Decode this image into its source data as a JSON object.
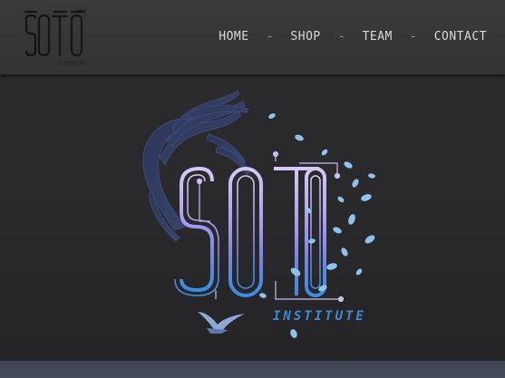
{
  "brand": {
    "logo_text": "SŌTŌ",
    "logo_subtext": "INSTITUTE"
  },
  "nav": {
    "items": [
      {
        "label": "HOME"
      },
      {
        "label": "SHOP"
      },
      {
        "label": "TEAM"
      },
      {
        "label": "CONTACT"
      }
    ],
    "separator": "-"
  },
  "hero": {
    "title": "SŌTŌ",
    "subtitle": "INSTITUTE"
  },
  "colors": {
    "background": "#2a2a2c",
    "header": "#373739",
    "nav_text": "#d9d9d9",
    "accent_blue": "#3d8bd6",
    "accent_purple": "#b7a6ef",
    "leaf_blue": "#8fc3ee",
    "footer_strip": "#424855"
  }
}
